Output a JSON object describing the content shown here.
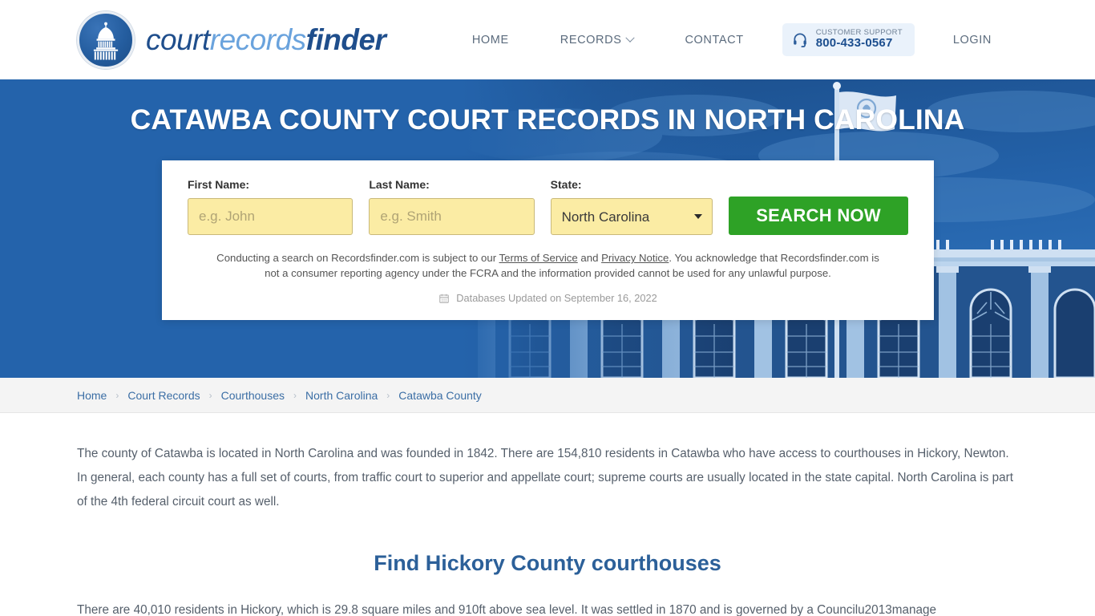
{
  "header": {
    "logo": {
      "icon": "capitol-dome-icon",
      "part1": "court",
      "part2": "records",
      "part3": "finder"
    },
    "nav": [
      {
        "label": "HOME",
        "name": "nav-home",
        "caret": false
      },
      {
        "label": "RECORDS",
        "name": "nav-records",
        "caret": true
      },
      {
        "label": "CONTACT",
        "name": "nav-contact",
        "caret": false
      }
    ],
    "support": {
      "icon": "headset-icon",
      "label": "CUSTOMER SUPPORT",
      "phone": "800-433-0567"
    },
    "login_label": "LOGIN"
  },
  "hero": {
    "title": "CATAWBA COUNTY COURT RECORDS IN NORTH CAROLINA",
    "background_color": "#2463ab",
    "photo_alt": "courthouse-building-photo"
  },
  "search": {
    "first_name": {
      "label": "First Name:",
      "placeholder": "e.g. John",
      "value": ""
    },
    "last_name": {
      "label": "Last Name:",
      "placeholder": "e.g. Smith",
      "value": ""
    },
    "state": {
      "label": "State:",
      "selected": "North Carolina",
      "options": [
        "North Carolina"
      ]
    },
    "button_label": "SEARCH NOW",
    "button_color": "#2ea226",
    "disclaimer": {
      "pre": "Conducting a search on Recordsfinder.com is subject to our ",
      "link1": "Terms of Service",
      "mid": " and ",
      "link2": "Privacy Notice",
      "post": ". You acknowledge that Recordsfinder.com is not a consumer reporting agency under the FCRA and the information provided cannot be used for any unlawful purpose."
    },
    "updated": {
      "icon": "calendar-icon",
      "text": "Databases Updated on September 16, 2022"
    }
  },
  "breadcrumb": {
    "separator": "›",
    "items": [
      {
        "label": "Home",
        "name": "breadcrumb-home"
      },
      {
        "label": "Court Records",
        "name": "breadcrumb-court-records"
      },
      {
        "label": "Courthouses",
        "name": "breadcrumb-courthouses"
      },
      {
        "label": "North Carolina",
        "name": "breadcrumb-north-carolina"
      },
      {
        "label": "Catawba County",
        "name": "breadcrumb-catawba-county"
      }
    ]
  },
  "main": {
    "intro_paragraph": "The county of Catawba is located in North Carolina and was founded in 1842. There are 154,810 residents in Catawba who have access to courthouses in Hickory, Newton. In general, each county has a full set of courts, from traffic court to superior and appellate court; supreme courts are usually located in the state capital. North Carolina is part of the 4th federal circuit court as well.",
    "section_heading": "Find Hickory County courthouses",
    "section_paragraph": "There are 40,010 residents in Hickory, which is 29.8 square miles and 910ft above sea level. It was settled in 1870 and is governed by a Councilu2013manage"
  }
}
